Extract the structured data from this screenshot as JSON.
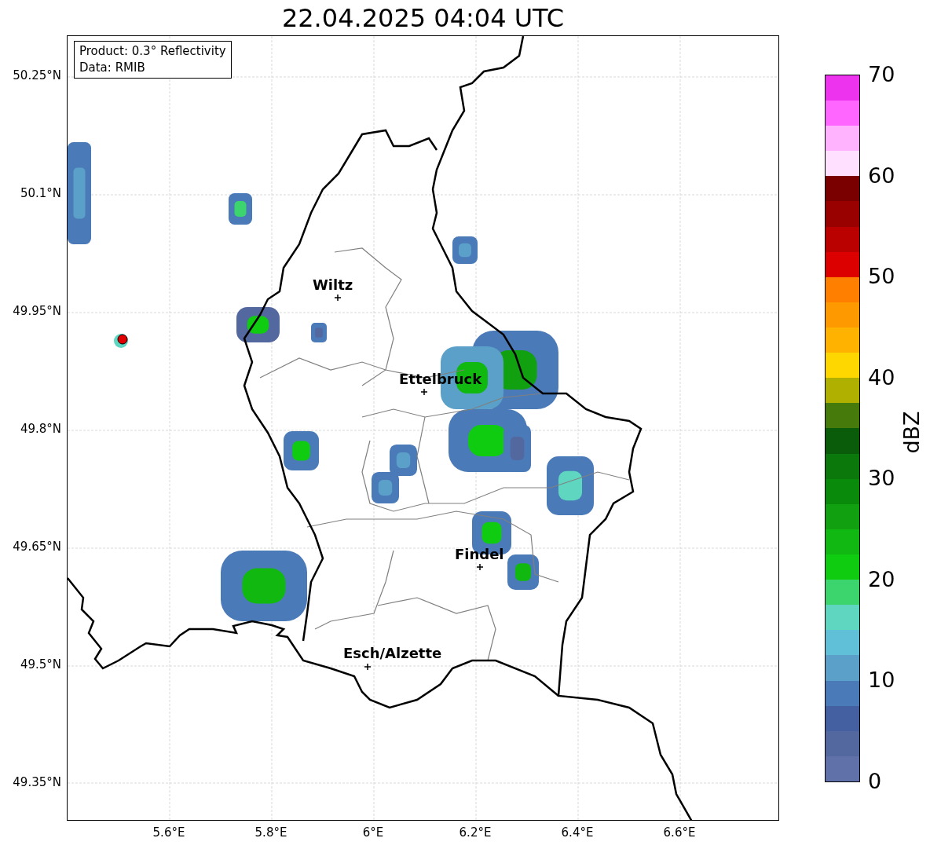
{
  "title": "22.04.2025 04:04 UTC",
  "info_box": {
    "lines": [
      "Product: 0.3° Reflectivity",
      "Data: RMIB"
    ]
  },
  "map": {
    "yticks": [
      "50.25°N",
      "50.1°N",
      "49.95°N",
      "49.8°N",
      "49.65°N",
      "49.5°N",
      "49.35°N"
    ],
    "xticks": [
      "5.6°E",
      "5.8°E",
      "6°E",
      "6.2°E",
      "6.4°E",
      "6.6°E"
    ],
    "places": [
      {
        "name": "Wiltz"
      },
      {
        "name": "Ettelbruck"
      },
      {
        "name": "Findel"
      },
      {
        "name": "Esch/Alzette"
      }
    ]
  },
  "colorbar": {
    "label": "dBZ",
    "ticks": [
      "70",
      "60",
      "50",
      "40",
      "30",
      "20",
      "10",
      "0"
    ],
    "segments": [
      {
        "color": "#6070a8"
      },
      {
        "color": "#5468a0"
      },
      {
        "color": "#4460a0"
      },
      {
        "color": "#4a7ab8"
      },
      {
        "color": "#5aa0c8"
      },
      {
        "color": "#60c0d8"
      },
      {
        "color": "#5ed6c0"
      },
      {
        "color": "#3cd46c"
      },
      {
        "color": "#10cc10"
      },
      {
        "color": "#12b812"
      },
      {
        "color": "#10a010"
      },
      {
        "color": "#0a8a0a"
      },
      {
        "color": "#0a780a"
      },
      {
        "color": "#0a5c0a"
      },
      {
        "color": "#467a0a"
      },
      {
        "color": "#b0b000"
      },
      {
        "color": "#ffd700"
      },
      {
        "color": "#ffb300"
      },
      {
        "color": "#ff9900"
      },
      {
        "color": "#ff7f00"
      },
      {
        "color": "#dd0000"
      },
      {
        "color": "#bb0000"
      },
      {
        "color": "#990000"
      },
      {
        "color": "#7a0000"
      },
      {
        "color": "#ffe0ff"
      },
      {
        "color": "#ffb3ff"
      },
      {
        "color": "#ff66ff"
      },
      {
        "color": "#ee33ee"
      }
    ]
  }
}
